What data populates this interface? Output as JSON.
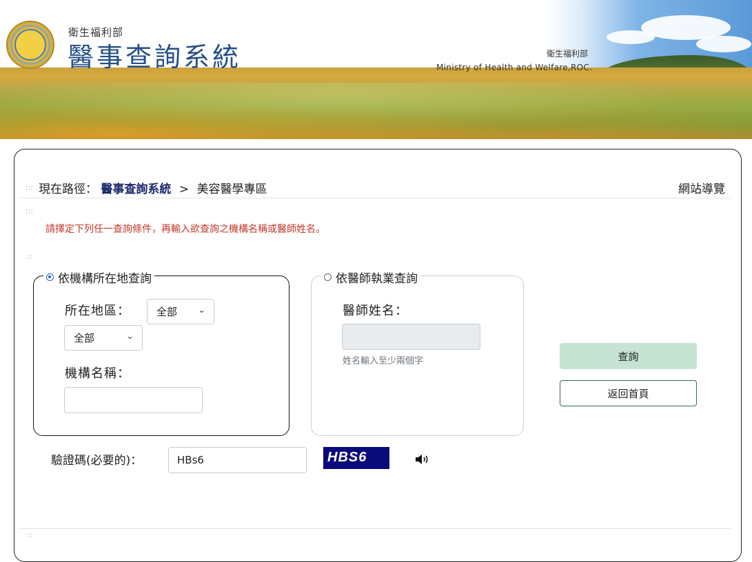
{
  "header": {
    "subtitle": "衛生福利部",
    "title": "醫事查詢系統",
    "ministry_zh": "衛生福利部",
    "ministry_en": "Ministry of Health and Welfare,ROC."
  },
  "breadcrumb": {
    "prefix": "現在路徑：",
    "link": "醫事查詢系統",
    "separator": ">",
    "current": "美容醫學專區",
    "sitemap": "網站導覽"
  },
  "dots": ":::",
  "instruction": "請擇定下列任一查詢條件，再輸入欲查詢之機構名稱或醫師姓名。",
  "group_location": {
    "legend": "依機構所在地查詢",
    "selected": true,
    "region_label": "所在地區：",
    "region_select": "全部",
    "district_select": "全部",
    "name_label": "機構名稱：",
    "name_value": ""
  },
  "group_doctor": {
    "legend": "依醫師執業查詢",
    "selected": false,
    "name_label": "醫師姓名：",
    "name_value": "",
    "hint": "姓名輸入至少兩個字"
  },
  "buttons": {
    "query": "查詢",
    "home": "返回首頁"
  },
  "captcha": {
    "label": "驗證碼(必要的)：",
    "input_value": "HBs6",
    "image_text": "HBS6"
  },
  "colors": {
    "title_blue": "#234f86",
    "instruction_red": "#c0392b",
    "query_button_bg": "#c6e3d4",
    "home_button_border": "#2e6b57",
    "captcha_bg": "#0a0a7a"
  }
}
